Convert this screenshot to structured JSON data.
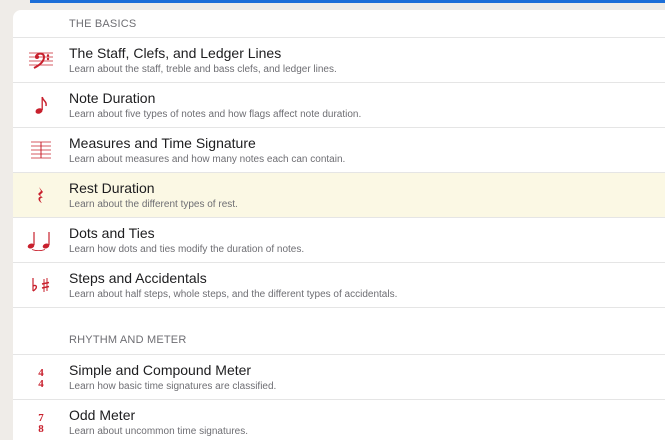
{
  "sections": [
    {
      "header": "THE BASICS",
      "items": [
        {
          "icon": "bass-clef-icon",
          "title": "The Staff, Clefs, and Ledger Lines",
          "desc": "Learn about the staff, treble and bass clefs, and ledger lines."
        },
        {
          "icon": "eighth-note-icon",
          "title": "Note Duration",
          "desc": "Learn about five types of notes and how flags affect note duration."
        },
        {
          "icon": "staff-measure-icon",
          "title": "Measures and Time Signature",
          "desc": "Learn about measures and how many notes each can contain."
        },
        {
          "icon": "quarter-rest-icon",
          "title": "Rest Duration",
          "desc": "Learn about the different types of rest."
        },
        {
          "icon": "tied-notes-icon",
          "title": "Dots and Ties",
          "desc": "Learn how dots and ties modify the duration of notes."
        },
        {
          "icon": "flat-sharp-icon",
          "title": "Steps and Accidentals",
          "desc": "Learn about half steps, whole steps, and the different types of accidentals."
        }
      ]
    },
    {
      "header": "RHYTHM AND METER",
      "items": [
        {
          "icon": "time-signature-4-4-icon",
          "title": "Simple and Compound Meter",
          "desc": "Learn how basic time signatures are classified."
        },
        {
          "icon": "time-signature-7-icon",
          "title": "Odd Meter",
          "desc": "Learn about uncommon time signatures."
        }
      ]
    }
  ],
  "colors": {
    "accent": "#c8202d",
    "selected_row": "#fbf8e4",
    "top_bar": "#1d6fd8"
  }
}
